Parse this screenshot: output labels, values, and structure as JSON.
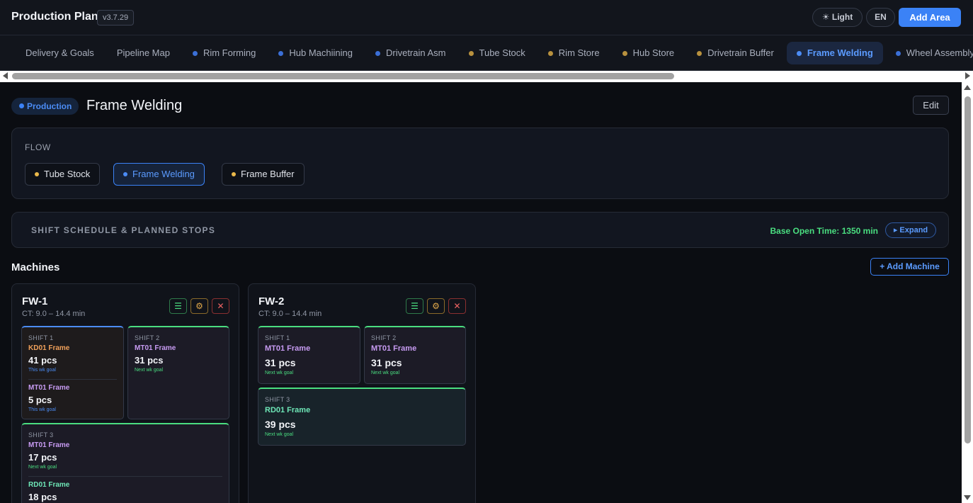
{
  "header": {
    "title": "Production Plan",
    "version": "v3.7.29",
    "light_label": "Light",
    "lang_label": "EN",
    "add_area_label": "Add Area"
  },
  "tabs": [
    {
      "label": "Delivery & Goals",
      "dot": null,
      "active": false
    },
    {
      "label": "Pipeline Map",
      "dot": null,
      "active": false
    },
    {
      "label": "Rim Forming",
      "dot": "#3b6fd6",
      "active": false
    },
    {
      "label": "Hub Machiining",
      "dot": "#3b6fd6",
      "active": false
    },
    {
      "label": "Drivetrain Asm",
      "dot": "#3b6fd6",
      "active": false
    },
    {
      "label": "Tube Stock",
      "dot": "#b8913e",
      "active": false
    },
    {
      "label": "Rim Store",
      "dot": "#b8913e",
      "active": false
    },
    {
      "label": "Hub Store",
      "dot": "#b8913e",
      "active": false
    },
    {
      "label": "Drivetrain Buffer",
      "dot": "#b8913e",
      "active": false
    },
    {
      "label": "Frame Welding",
      "dot": "#4b8cf5",
      "active": true
    },
    {
      "label": "Wheel Assembly",
      "dot": "#3b6fd6",
      "active": false
    }
  ],
  "page": {
    "badge": "Production",
    "title": "Frame Welding",
    "edit_label": "Edit"
  },
  "flow": {
    "label": "FLOW",
    "chips": [
      {
        "label": "Tube Stock",
        "dot": "#eab84a",
        "active": false
      },
      {
        "label": "Frame Welding",
        "dot": "#4b8cf5",
        "active": true
      },
      {
        "label": "Frame Buffer",
        "dot": "#eab84a",
        "active": false
      }
    ]
  },
  "shift_schedule": {
    "title": "SHIFT SCHEDULE & PLANNED STOPS",
    "base_open": "Base Open Time: 1350 min",
    "expand_label": "▸ Expand"
  },
  "machines": {
    "title": "Machines",
    "add_label": "+ Add Machine",
    "list": [
      {
        "name": "FW-1",
        "ct": "CT: 9.0 – 14.4 min",
        "shifts": [
          {
            "label": "SHIFT 1",
            "items": [
              {
                "product": "KD01 Frame",
                "pcs": "41 pcs",
                "goal": "This wk goal"
              },
              {
                "product": "MT01 Frame",
                "pcs": "5 pcs",
                "goal": "This wk goal"
              }
            ]
          },
          {
            "label": "SHIFT 2",
            "items": [
              {
                "product": "MT01 Frame",
                "pcs": "31 pcs",
                "goal": "Next wk goal"
              }
            ]
          },
          {
            "label": "SHIFT 3",
            "items": [
              {
                "product": "MT01 Frame",
                "pcs": "17 pcs",
                "goal": "Next wk goal"
              },
              {
                "product": "RD01 Frame",
                "pcs": "18 pcs",
                "goal": ""
              }
            ]
          }
        ]
      },
      {
        "name": "FW-2",
        "ct": "CT: 9.0 – 14.4 min",
        "shifts": [
          {
            "label": "SHIFT 1",
            "items": [
              {
                "product": "MT01 Frame",
                "pcs": "31 pcs",
                "goal": "Next wk goal"
              }
            ]
          },
          {
            "label": "SHIFT 2",
            "items": [
              {
                "product": "MT01 Frame",
                "pcs": "31 pcs",
                "goal": "Next wk goal"
              }
            ]
          },
          {
            "label": "SHIFT 3",
            "items": [
              {
                "product": "RD01 Frame",
                "pcs": "39 pcs",
                "goal": "Next wk goal"
              }
            ]
          }
        ]
      }
    ]
  },
  "colors": {
    "accent": "#3b82f6",
    "green": "#4ade80",
    "kd_product": "#f0a05a",
    "mt_product": "#c79bf2",
    "rd_product": "#6ee7b7"
  }
}
